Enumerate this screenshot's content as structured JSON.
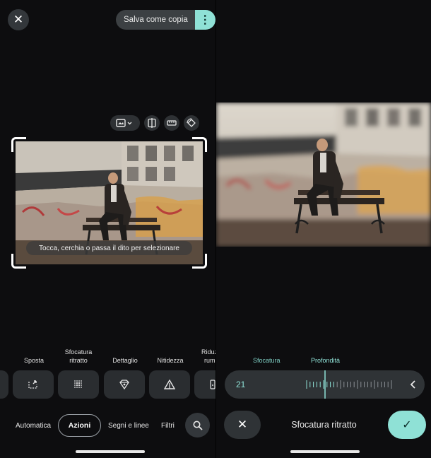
{
  "left": {
    "close_icon": "✕",
    "save_copy_label": "Salva come copia",
    "more_icon": "⋮",
    "hint": "Tocca, cerchia o passa il dito per selezionare",
    "actions": [
      {
        "label": "Sposta",
        "icon": "move-icon"
      },
      {
        "label": "Sfocatura ritratto",
        "icon": "portrait-blur-icon"
      },
      {
        "label": "Dettaglio",
        "icon": "detail-icon"
      },
      {
        "label": "Nitidezza",
        "icon": "sharpness-icon"
      },
      {
        "label": "Riduz rum",
        "icon": "denoise-icon"
      }
    ],
    "action_labels": {
      "move": "Sposta",
      "blur_1": "Sfocatura",
      "blur_2": "ritratto",
      "detail": "Dettaglio",
      "sharp": "Nitidezza",
      "noise_1": "Riduz",
      "noise_2": "rum"
    },
    "tabs": {
      "auto": "Automatica",
      "actions": "Azioni",
      "marks": "Segni e linee",
      "filters": "Filtri"
    }
  },
  "right": {
    "slider_labels": {
      "blur": "Sfocatura",
      "depth": "Profondità"
    },
    "slider_value": "21",
    "slider_level": 0.34,
    "title": "Sfocatura ritratto",
    "cancel_icon": "✕",
    "confirm_icon": "✓"
  },
  "colors": {
    "background": "#0d0d0f",
    "accent": "#8fe1d6",
    "surface": "#2f3336"
  }
}
